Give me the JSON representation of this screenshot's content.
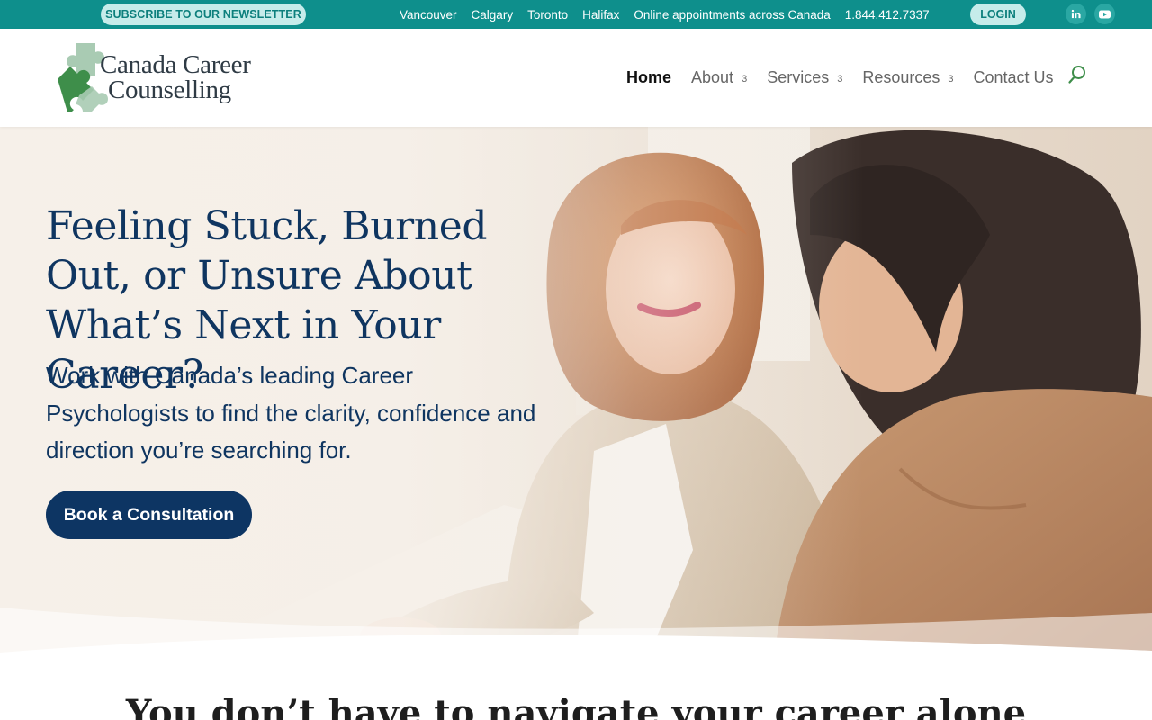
{
  "topbar": {
    "newsletter_label": "SUBSCRIBE TO OUR NEWSLETTER",
    "links": [
      "Vancouver",
      "Calgary",
      "Toronto",
      "Halifax",
      "Online appointments across Canada"
    ],
    "phone": "1.844.412.7337",
    "login_label": "LOGIN",
    "social": [
      "linkedin-icon",
      "youtube-icon"
    ]
  },
  "header": {
    "logo_line1": "Canada Career",
    "logo_line2": "Counselling",
    "nav": [
      {
        "label": "Home",
        "active": true
      },
      {
        "label": "About",
        "caret": "3"
      },
      {
        "label": "Services",
        "caret": "3"
      },
      {
        "label": "Resources",
        "caret": "3"
      },
      {
        "label": "Contact Us"
      }
    ]
  },
  "hero": {
    "title": "Feeling Stuck, Burned Out, or Unsure About What’s Next in Your Career?",
    "subtitle": "Work with Canada’s leading Career Psychologists to find the clarity, confidence and direction you’re searching for.",
    "cta_label": "Book a Consultation"
  },
  "section2": {
    "title": "You don’t have to navigate your career alone"
  },
  "colors": {
    "topbar": "#0e8f8c",
    "pill": "#c6ecea",
    "navy": "#0f3560",
    "logo_green_dark": "#3e8e4a",
    "logo_green_light": "#a9cbb3"
  }
}
